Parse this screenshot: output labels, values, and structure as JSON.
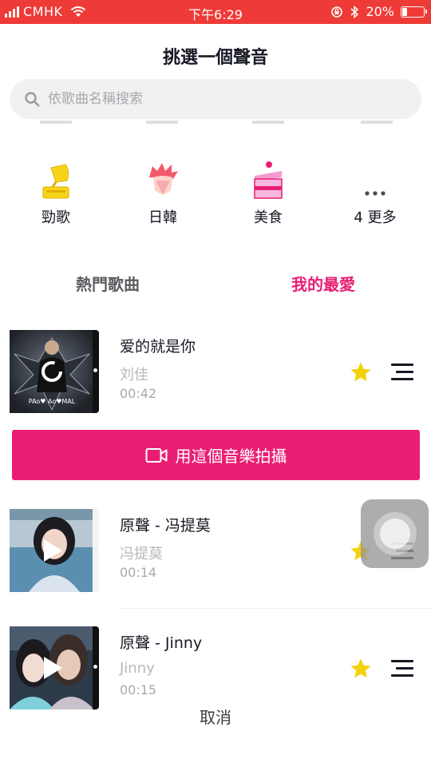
{
  "status_bar": {
    "carrier": "CMHK",
    "time": "下午6:29",
    "battery_text": "20%",
    "battery_level": 0.2,
    "accent_color": "#ee3b37"
  },
  "sheet": {
    "title": "挑選一個聲音",
    "search_placeholder": "依歌曲名稱搜索"
  },
  "categories": [
    {
      "label": "勁歌",
      "icon": "gramophone-icon"
    },
    {
      "label": "日韓",
      "icon": "anime-face-icon"
    },
    {
      "label": "美食",
      "icon": "cake-icon"
    },
    {
      "label": "4 更多",
      "icon": "more-dots-icon"
    }
  ],
  "tabs": [
    {
      "label": "熱門歌曲",
      "selected": false
    },
    {
      "label": "我的最愛",
      "selected": true
    }
  ],
  "songs": [
    {
      "title": "爱的就是你",
      "artist": "刘佳",
      "duration": "00:42",
      "cover_text": "PAo♥ Ao♥MAL",
      "favorited": true,
      "loading": true
    },
    {
      "title": "原聲 - 冯提莫",
      "artist": "冯提莫",
      "duration": "00:14",
      "favorited": true,
      "loading": false
    },
    {
      "title": "原聲 - Jinny",
      "artist": "Jinny",
      "duration": "00:15",
      "favorited": true,
      "loading": false
    }
  ],
  "use_button_label": "用這個音樂拍攝",
  "cancel_label": "取消",
  "colors": {
    "brand_pink": "#e91e73",
    "star_yellow": "#f5d10b"
  }
}
